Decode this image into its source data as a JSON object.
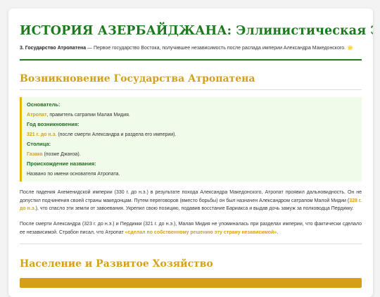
{
  "page": {
    "title": "ИСТОРИЯ АЗЕРБАЙДЖАНА: Эллинистическая Эпоха",
    "intro": {
      "number": "3.",
      "name": "Государство Атропатена",
      "text": " — Первое государство Востока, получившее независимость после распада империи Александра Македонского.",
      "star": "🌟"
    }
  },
  "section1": {
    "title": "Возникновение Государства Атропатена",
    "infobox": {
      "founder_label": "Основатель:",
      "founder_name": "Атропат",
      "founder_rest": ", правитель сатрапии Малая Мидия.",
      "year_label": "Год возникновения:",
      "year_value": "321 г. до н.э.",
      "year_rest": " (после смерти Александра и раздела его империи).",
      "capital_label": "Столица:",
      "capital_name": "Газака",
      "capital_rest": " (позже Джанза).",
      "origin_label": "Происхождение названия:",
      "origin_value": "Названо по имени основателя Атропата."
    },
    "para1": {
      "before": "После падения Ахеменидской империи (330 г. до н.э.) в результате похода Александра Македонского, Атропат проявил дальновидность. Он не допустил подчинения своей страны македонцам. Путем переговоров (вместо борьбы) он был назначен Александром сатрапом Малой Мидии (",
      "date": "328 г. до н.э.",
      "after": "), что спасло эти земли от завоевания. Укрепил свою позицию, подавив восстание Бариакса и выдав дочь замуж за полководца Пердикку."
    },
    "para2": {
      "before": "После смерти Александра (323 г. до н.э.) и Пердикки (321 г. до н.э.), Малая Мидия не упоминалась при разделах империи, что фактически сделало ее независимой. Страбон писал, что Атропат ",
      "quote": "«сделал по собственному решению эту страну независимой»",
      "after": "."
    }
  },
  "section2": {
    "title": "Население и Развитое Хозяйство"
  },
  "colors": {
    "title_green": "#1f7a1f",
    "accent_gold": "#d4a017",
    "infobox_bg": "#f1fbea"
  }
}
